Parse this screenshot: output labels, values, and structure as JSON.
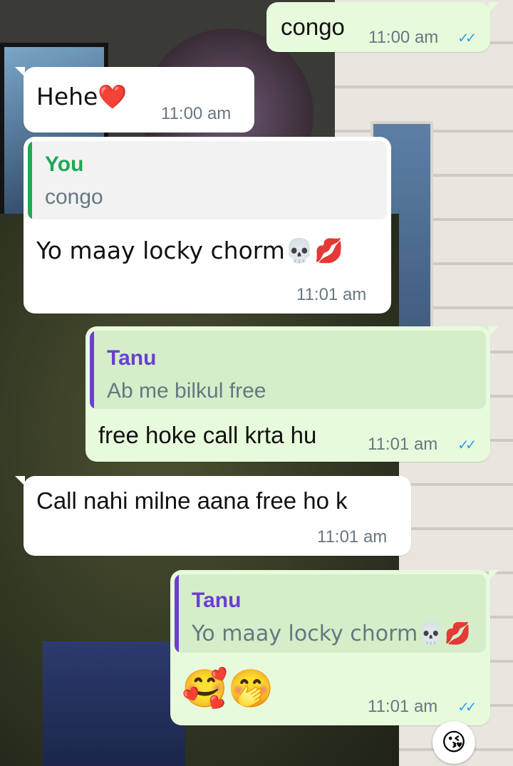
{
  "messages": [
    {
      "direction": "out",
      "text": "congo",
      "time": "11:00 am",
      "status": "✓✓"
    },
    {
      "direction": "in",
      "text": "Hehe❤️",
      "time": "11:00 am"
    },
    {
      "direction": "in",
      "quote": {
        "author": "You",
        "text": "congo"
      },
      "text": "Yo maay locky chorm💀💋",
      "time": "11:01 am"
    },
    {
      "direction": "out",
      "quote": {
        "author": "Tanu",
        "text": "Ab me bilkul free"
      },
      "text": "free hoke call krta hu",
      "time": "11:01 am",
      "status": "✓✓"
    },
    {
      "direction": "in",
      "text": "Call nahi milne aana free ho k",
      "time": "11:01 am"
    },
    {
      "direction": "out",
      "quote": {
        "author": "Tanu",
        "text": "Yo maay locky chorm💀💋"
      },
      "text": "🥰🤭",
      "time": "11:01 am",
      "status": "✓✓",
      "reaction": "😘"
    }
  ],
  "colors": {
    "outgoing_bubble": "#e7fbdc",
    "incoming_bubble": "#ffffff",
    "quote_author_you": "#1fa855",
    "quote_author_tanu": "#6b3fd1",
    "read_tick": "#34a0e6",
    "timestamp": "#667781"
  }
}
